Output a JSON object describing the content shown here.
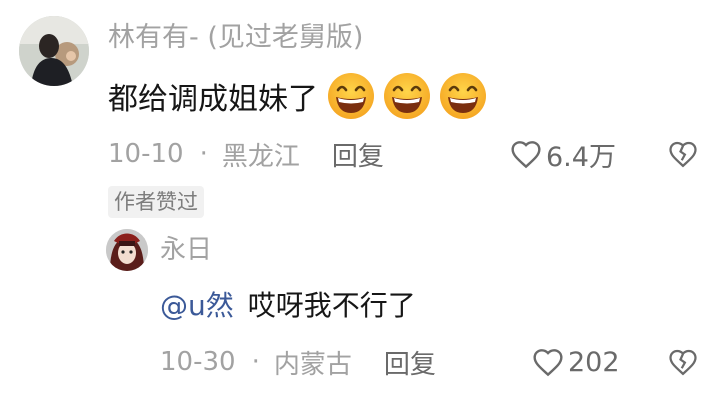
{
  "comment": {
    "author": "林有有- (见过老舅版)",
    "text": "都给调成姐妹了",
    "emoji_count": 3,
    "emoji_name": "grinning-face-icon",
    "date": "10-10",
    "separator": "·",
    "location": "黑龙江",
    "reply_label": "回复",
    "like_count": "6.4万",
    "author_liked_badge": "作者赞过"
  },
  "reply": {
    "author": "永日",
    "mention": "@u然",
    "text": "哎呀我不行了",
    "date": "10-30",
    "separator": "·",
    "location": "内蒙古",
    "reply_label": "回复",
    "like_count": "202"
  },
  "colors": {
    "text": "#161616",
    "muted": "#a2a2a2",
    "mention": "#3b5998",
    "badge_bg": "#f1f1f1"
  }
}
